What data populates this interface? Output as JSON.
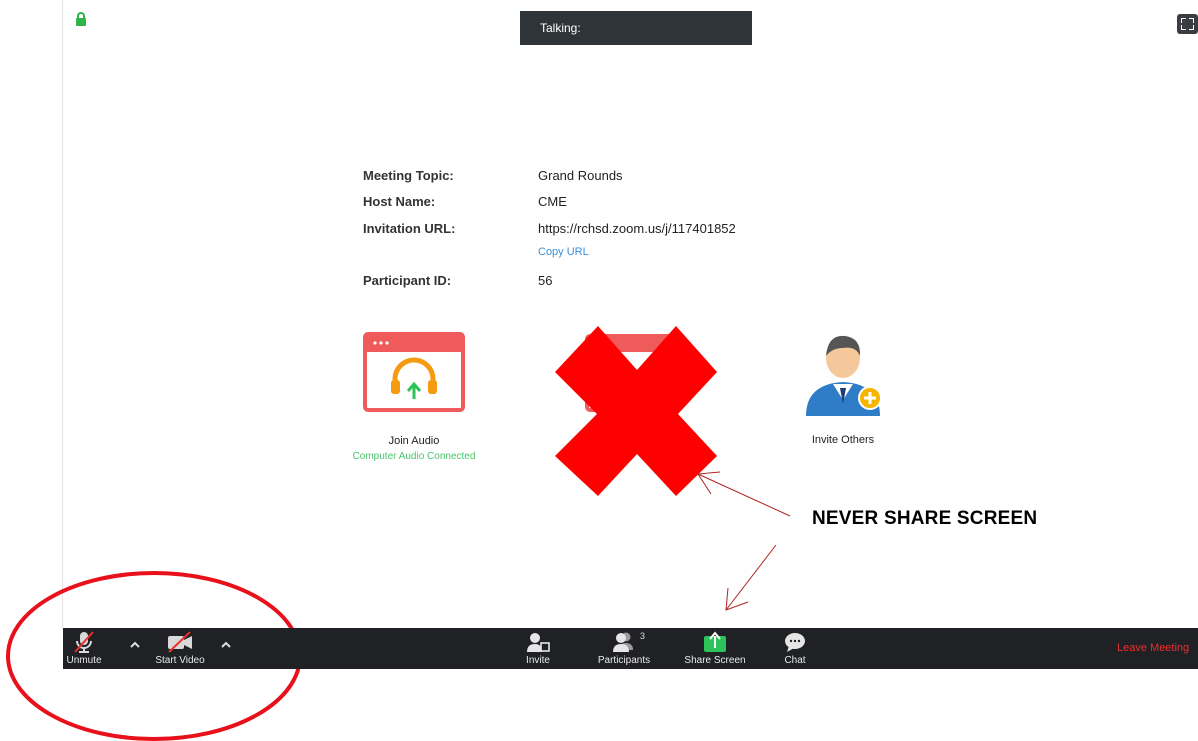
{
  "header": {
    "talking_label": "Talking:"
  },
  "meeting_info": {
    "topic_label": "Meeting Topic:",
    "topic_value": "Grand Rounds",
    "host_label": "Host Name:",
    "host_value": "CME",
    "url_label": "Invitation URL:",
    "url_value": "https://rchsd.zoom.us/j/117401852",
    "copy_url_label": "Copy URL",
    "participant_label": "Participant ID:",
    "participant_value": "56"
  },
  "tiles": {
    "join_audio_label": "Join Audio",
    "join_audio_status": "Computer Audio Connected",
    "invite_others_label": "Invite Others"
  },
  "annotation": {
    "warning_text": "NEVER SHARE SCREEN"
  },
  "toolbar": {
    "unmute_label": "Unmute",
    "start_video_label": "Start Video",
    "invite_label": "Invite",
    "participants_label": "Participants",
    "participants_count": "3",
    "share_screen_label": "Share Screen",
    "chat_label": "Chat",
    "leave_label": "Leave Meeting"
  },
  "icons": {
    "lock": "lock-icon",
    "fullscreen": "fullscreen-icon",
    "mic_muted": "microphone-muted-icon",
    "video_off": "video-off-icon",
    "invite": "invite-icon",
    "participants": "participants-icon",
    "share": "share-screen-icon",
    "chat": "chat-icon",
    "headphones": "headphones-icon",
    "person_add": "person-add-icon"
  },
  "colors": {
    "toolbar_bg": "#1f2124",
    "leave_red": "#e8302e",
    "share_green": "#2ec25a",
    "annotation_red": "#ff0000",
    "link_blue": "#3b8fd9"
  }
}
